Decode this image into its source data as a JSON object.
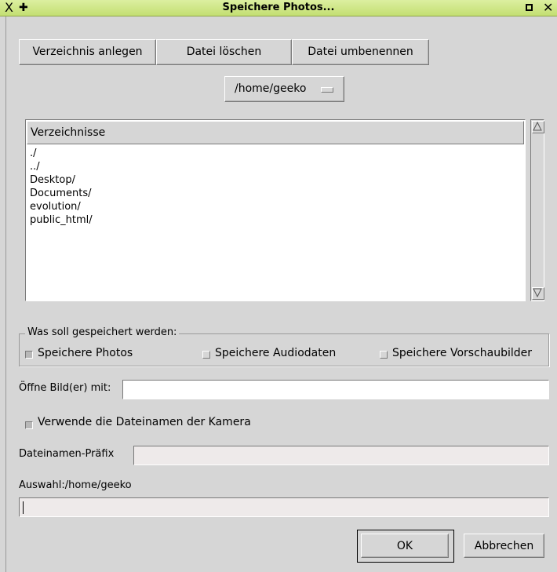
{
  "window": {
    "title": "Speichere Photos...",
    "icons": [
      "x-logo-icon",
      "pin-icon",
      "maximize-icon",
      "close-icon"
    ]
  },
  "toolbar": {
    "create_dir": "Verzeichnis anlegen",
    "delete_file": "Datei löschen",
    "rename_file": "Datei umbenennen"
  },
  "path_selector": {
    "value": "/home/geeko"
  },
  "directory_list": {
    "header": "Verzeichnisse",
    "items": [
      "./",
      "../",
      "Desktop/",
      "Documents/",
      "evolution/",
      "public_html/"
    ]
  },
  "save_group": {
    "label": "Was soll gespeichert werden:",
    "options": [
      {
        "label": "Speichere Photos",
        "checked": true
      },
      {
        "label": "Speichere Audiodaten",
        "checked": false
      },
      {
        "label": "Speichere Vorschaubilder",
        "checked": false
      }
    ]
  },
  "open_with": {
    "label": "Öffne Bild(er) mit:",
    "value": ""
  },
  "use_camera_names": {
    "label": "Verwende die Dateinamen der Kamera",
    "checked": true
  },
  "prefix": {
    "label": "Dateinamen-Präfix",
    "value": ""
  },
  "selection": {
    "label": "Auswahl:/home/geeko",
    "value": ""
  },
  "buttons": {
    "ok": "OK",
    "cancel": "Abbrechen"
  }
}
